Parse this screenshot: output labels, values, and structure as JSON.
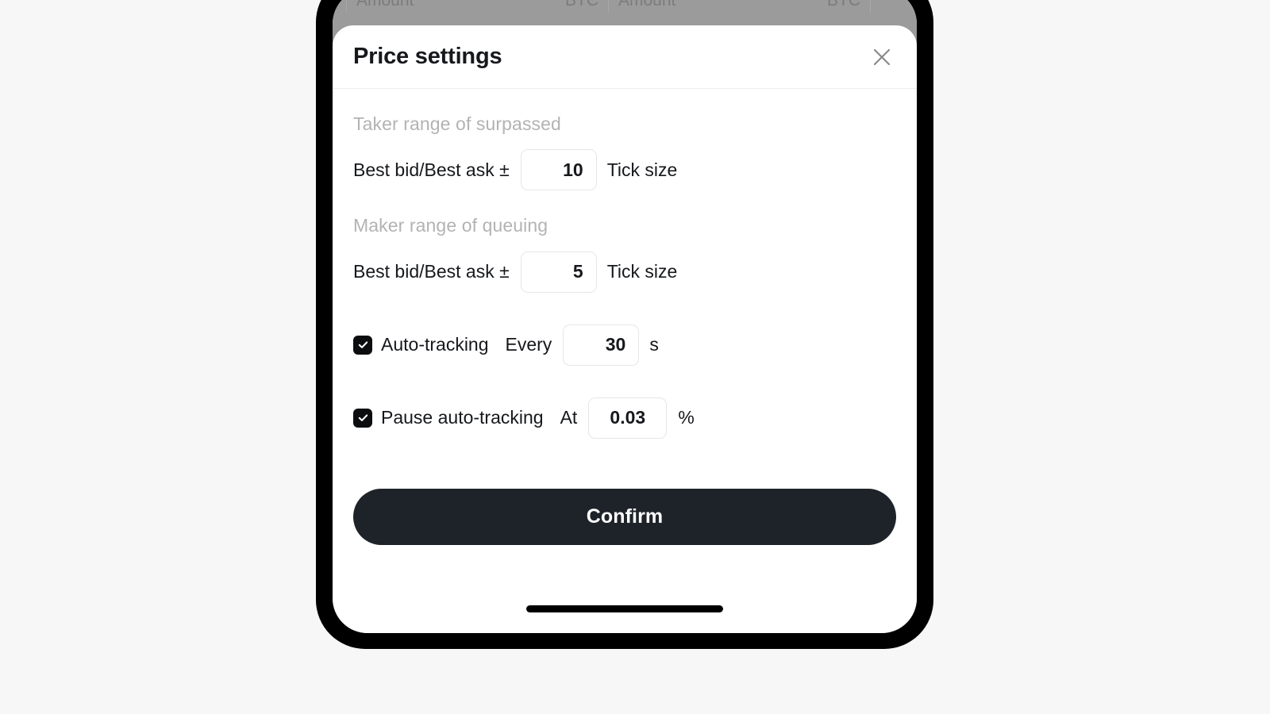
{
  "background_app": {
    "columns": [
      {
        "left": "Amount",
        "right": "BTC"
      },
      {
        "left": "Amount",
        "right": "BTC"
      }
    ]
  },
  "sheet": {
    "title": "Price settings",
    "close_icon": "close-icon",
    "taker": {
      "section_label": "Taker range of surpassed",
      "prefix_label": "Best bid/Best ask ±",
      "value": "10",
      "suffix_label": "Tick size"
    },
    "maker": {
      "section_label": "Maker range of queuing",
      "prefix_label": "Best bid/Best ask ±",
      "value": "5",
      "suffix_label": "Tick size"
    },
    "auto_tracking": {
      "checked": true,
      "label": "Auto-tracking",
      "prefix_label": "Every",
      "value": "30",
      "suffix_label": "s"
    },
    "pause_auto_tracking": {
      "checked": true,
      "label": "Pause auto-tracking",
      "prefix_label": "At",
      "value": "0.03",
      "suffix_label": "%"
    },
    "confirm_label": "Confirm"
  },
  "colors": {
    "page_background": "#f7f7f7",
    "device_frame": "#000000",
    "sheet_background": "#ffffff",
    "backdrop_dim": "#9b9b9b",
    "primary_text": "#16181c",
    "muted_text": "#b3b3b3",
    "input_border": "#e6e6e6",
    "checkbox_fill": "#0b0d0f",
    "confirm_button": "#1e2329",
    "close_icon": "#8a8a8a"
  }
}
